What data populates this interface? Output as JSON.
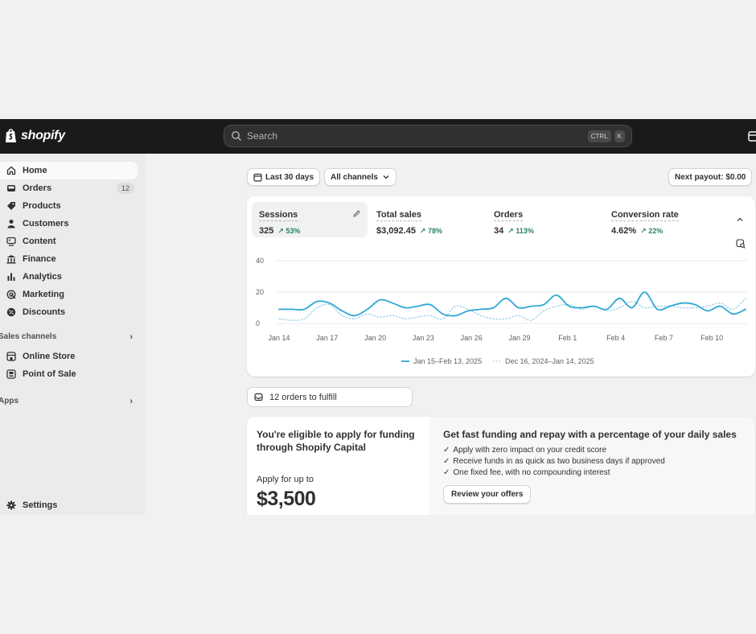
{
  "app": {
    "brand": "shopify",
    "search": {
      "placeholder": "Search",
      "shortcut_key1": "CTRL",
      "shortcut_key2": "K"
    }
  },
  "sidebar": {
    "items": [
      {
        "label": "Home",
        "icon": "home-icon",
        "active": true
      },
      {
        "label": "Orders",
        "icon": "inbox-icon",
        "badge": "12"
      },
      {
        "label": "Products",
        "icon": "tag-icon"
      },
      {
        "label": "Customers",
        "icon": "person-icon"
      },
      {
        "label": "Content",
        "icon": "content-icon"
      },
      {
        "label": "Finance",
        "icon": "bank-icon"
      },
      {
        "label": "Analytics",
        "icon": "bar-chart-icon"
      },
      {
        "label": "Marketing",
        "icon": "target-icon"
      },
      {
        "label": "Discounts",
        "icon": "discount-icon"
      }
    ],
    "sales_channels_label": "Sales channels",
    "channels": [
      {
        "label": "Online Store",
        "icon": "storefront-icon"
      },
      {
        "label": "Point of Sale",
        "icon": "pos-icon"
      }
    ],
    "apps_label": "Apps",
    "settings_label": "Settings"
  },
  "filters": {
    "date_range": "Last 30 days",
    "channels": "All channels",
    "next_payout": "Next payout: $0.00"
  },
  "metrics": [
    {
      "label": "Sessions",
      "value": "325",
      "change": "53%"
    },
    {
      "label": "Total sales",
      "value": "$3,092.45",
      "change": "78%"
    },
    {
      "label": "Orders",
      "value": "34",
      "change": "113%"
    },
    {
      "label": "Conversion rate",
      "value": "4.62%",
      "change": "22%"
    }
  ],
  "chart_data": {
    "type": "line",
    "x_tick_labels": [
      "Jan 14",
      "Jan 17",
      "Jan 20",
      "Jan 23",
      "Jan 26",
      "Jan 29",
      "Feb 1",
      "Feb 4",
      "Feb 7",
      "Feb 10"
    ],
    "y_tick_labels": [
      "0",
      "20",
      "40"
    ],
    "ylim": [
      0,
      40
    ],
    "grid": true,
    "legend_position": "bottom-center",
    "series": [
      {
        "name": "Jan 15–Feb 13, 2025",
        "style": "solid",
        "color": "#2fa8d5",
        "values": [
          9,
          9,
          9,
          14,
          13,
          8,
          5,
          9,
          15,
          13,
          10,
          11,
          12,
          6,
          5,
          8,
          9,
          10,
          16,
          10,
          11,
          12,
          18,
          11,
          10,
          11,
          9,
          16,
          10,
          20,
          9,
          11,
          13,
          12,
          8,
          11,
          6,
          9
        ]
      },
      {
        "name": "Dec 16, 2024–Jan 14, 2025",
        "style": "dotted",
        "color": "#8fcbe8",
        "values": [
          3,
          2,
          3,
          10,
          12,
          5,
          3,
          6,
          4,
          5,
          3,
          4,
          5,
          3,
          11,
          9,
          5,
          3,
          3,
          5,
          2,
          8,
          11,
          12,
          9,
          11,
          8,
          10,
          14,
          10,
          11,
          11,
          10,
          10,
          11,
          13,
          9,
          16
        ]
      }
    ]
  },
  "fulfill": {
    "label": "12 orders to fulfill"
  },
  "funding": {
    "title": "You're eligible to apply for funding through Shopify Capital",
    "apply_label": "Apply for up to",
    "amount": "$3,500",
    "right_title": "Get fast funding and repay with a percentage of your daily sales",
    "bullets": [
      "Apply with zero impact on your credit score",
      "Receive funds in as quick as two business days if approved",
      "One fixed fee, with no compounding interest"
    ],
    "cta": "Review your offers"
  }
}
